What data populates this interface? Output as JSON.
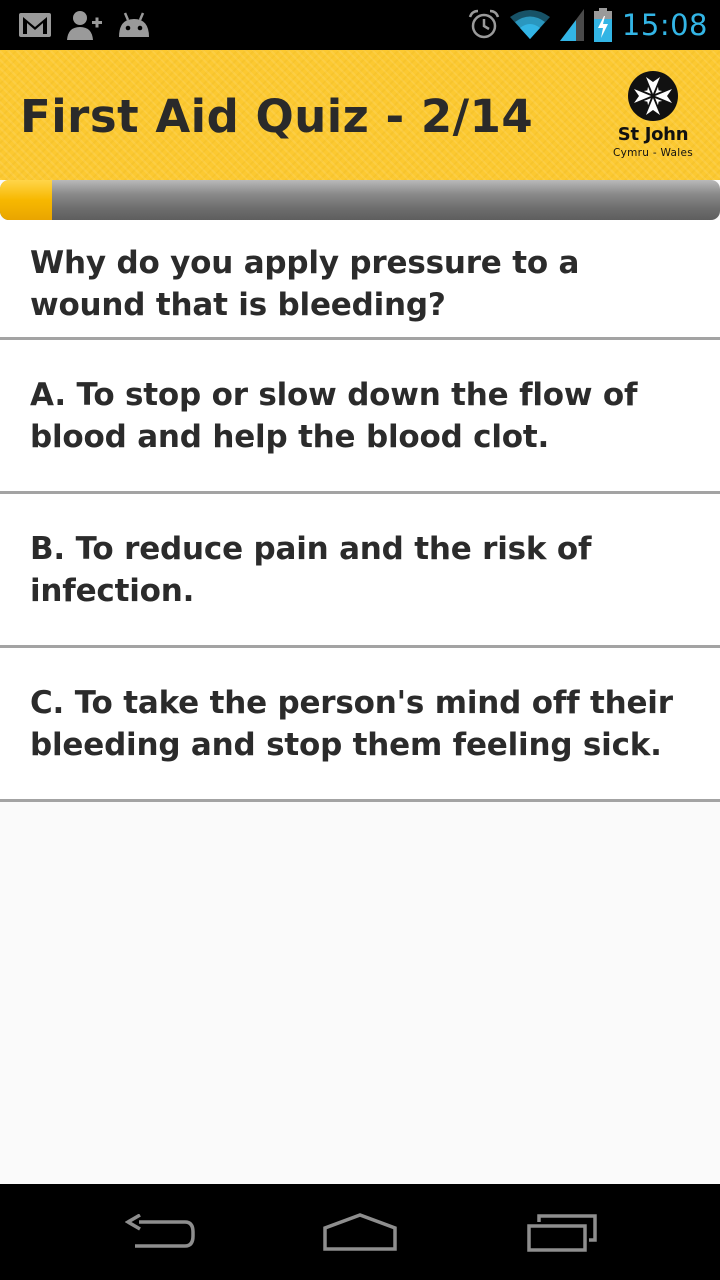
{
  "status_bar": {
    "time": "15:08",
    "left_icons": [
      "gmail-icon",
      "add-contact-icon",
      "android-icon"
    ],
    "right_icons": [
      "alarm-icon",
      "wifi-icon",
      "signal-icon",
      "battery-charging-icon"
    ],
    "accent_color": "#33b5e5"
  },
  "header": {
    "title": "First Aid Quiz - 2/14",
    "logo": {
      "name": "St John",
      "subtitle": "Cymru - Wales"
    },
    "background_color": "#fcc931"
  },
  "progress": {
    "current": 1,
    "total": 14,
    "fraction": 0.072
  },
  "question": {
    "text": "Why do you apply pressure to a wound that is bleeding?"
  },
  "options": [
    {
      "text": "A. To stop or slow down the flow of blood and help the blood clot."
    },
    {
      "text": "B. To reduce pain and the risk of infection."
    },
    {
      "text": "C. To take the person's mind off their bleeding and stop them feeling sick."
    }
  ],
  "nav_bar": {
    "icons": [
      "back-icon",
      "home-icon",
      "recent-apps-icon"
    ]
  }
}
